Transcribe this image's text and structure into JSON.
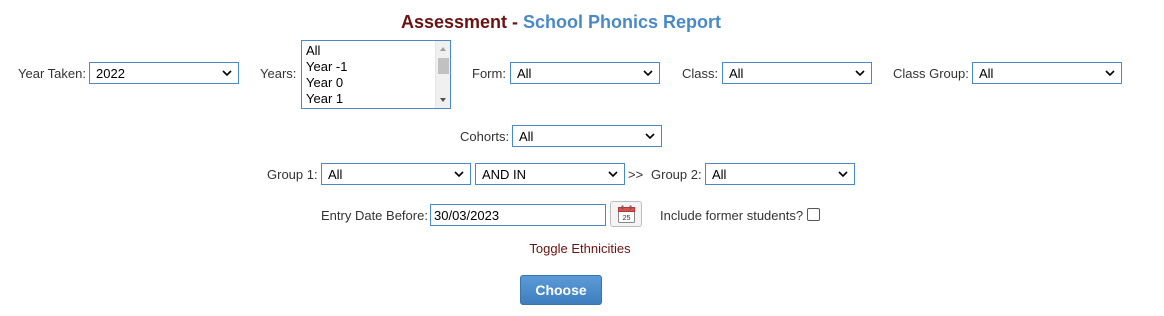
{
  "title": {
    "main": "Assessment",
    "sep": " - ",
    "sub": "School Phonics Report"
  },
  "filters": {
    "year_taken": {
      "label": "Year Taken:",
      "value": "2022"
    },
    "years": {
      "label": "Years:",
      "options": [
        "All",
        "Year -1",
        "Year 0",
        "Year 1"
      ]
    },
    "form": {
      "label": "Form:",
      "value": "All"
    },
    "class": {
      "label": "Class:",
      "value": "All"
    },
    "class_group": {
      "label": "Class Group:",
      "value": "All"
    },
    "cohorts": {
      "label": "Cohorts:",
      "value": "All"
    },
    "group1": {
      "label": "Group 1:",
      "value": "All"
    },
    "operator": {
      "value": "AND IN"
    },
    "arrows": ">>",
    "group2": {
      "label": "Group 2:",
      "value": "All"
    },
    "entry_date": {
      "label": "Entry Date Before:",
      "value": "30/03/2023"
    },
    "calendar": {
      "icon": "calendar-icon",
      "day": "25"
    },
    "include_former": {
      "label": "Include former students?",
      "checked": false
    }
  },
  "toggle_ethnicities": "Toggle Ethnicities",
  "choose_button": "Choose",
  "colors": {
    "title_main": "#6b1212",
    "title_sub": "#4a89c8",
    "border": "#4a89c8",
    "button": "#4a89c8"
  }
}
